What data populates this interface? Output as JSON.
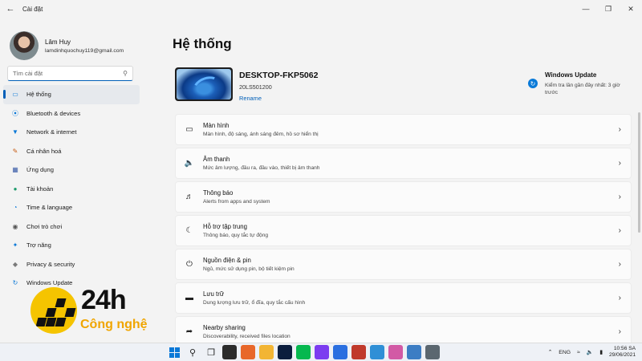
{
  "window": {
    "title": "Cài đặt",
    "back_icon": "back-arrow-icon",
    "controls": [
      "minimize-icon",
      "maximize-icon",
      "close-icon"
    ]
  },
  "profile": {
    "name": "Lâm Huy",
    "email": "lamdinhquochuy119@gmail.com"
  },
  "search": {
    "placeholder": "Tìm cài đặt",
    "icon": "search-icon"
  },
  "sidebar": {
    "items": [
      {
        "label": "Hệ thống",
        "icon": "system-icon",
        "color": "#0a78d7",
        "active": true
      },
      {
        "label": "Bluetooth & devices",
        "icon": "bluetooth-icon",
        "color": "#0a78d7"
      },
      {
        "label": "Network & internet",
        "icon": "wifi-icon",
        "color": "#0a78d7"
      },
      {
        "label": "Cá nhân hoá",
        "icon": "brush-icon",
        "color": "#c75b12"
      },
      {
        "label": "Ứng dụng",
        "icon": "apps-icon",
        "color": "#3a5ca8"
      },
      {
        "label": "Tài khoản",
        "icon": "account-icon",
        "color": "#1f9c6d"
      },
      {
        "label": "Time & language",
        "icon": "globe-icon",
        "color": "#0a78d7"
      },
      {
        "label": "Chơi trò chơi",
        "icon": "gamepad-icon",
        "color": "#555555"
      },
      {
        "label": "Trợ năng",
        "icon": "accessibility-icon",
        "color": "#0a78d7"
      },
      {
        "label": "Privacy & security",
        "icon": "shield-icon",
        "color": "#7a7a7a"
      },
      {
        "label": "Windows Update",
        "icon": "update-icon",
        "color": "#0a78d7"
      }
    ]
  },
  "main": {
    "title": "Hệ thống",
    "device": {
      "name": "DESKTOP-FKP5062",
      "model": "20LS501200",
      "rename": "Rename"
    },
    "windows_update": {
      "title": "Windows Update",
      "subtitle": "Kiểm tra lần gần đây nhất: 3 giờ trước"
    },
    "cards": [
      {
        "title": "Màn hình",
        "subtitle": "Màn hình, độ sáng, ánh sáng đêm, hồ sơ hiển thị",
        "icon": "display-icon"
      },
      {
        "title": "Âm thanh",
        "subtitle": "Mức âm lượng, đầu ra, đầu vào, thiết bị âm thanh",
        "icon": "speaker-icon"
      },
      {
        "title": "Thông báo",
        "subtitle": "Alerts from apps and system",
        "icon": "bell-icon"
      },
      {
        "title": "Hỗ trợ tập trung",
        "subtitle": "Thông báo, quy tắc tự động",
        "icon": "moon-icon"
      },
      {
        "title": "Nguồn điện & pin",
        "subtitle": "Ngủ, mức sử dụng pin, bộ tiết kiệm pin",
        "icon": "power-icon"
      },
      {
        "title": "Lưu trữ",
        "subtitle": "Dung lượng lưu trữ, ổ đĩa, quy tắc cấu hình",
        "icon": "storage-icon"
      },
      {
        "title": "Nearby sharing",
        "subtitle": "Discoverability, received files location",
        "icon": "share-icon"
      }
    ]
  },
  "watermark": {
    "brand": "24h",
    "tagline": "Công nghệ"
  },
  "taskbar": {
    "apps": [
      {
        "name": "start-icon",
        "color": "#0a78d7"
      },
      {
        "name": "taskbar-search-icon",
        "color": "#222222"
      },
      {
        "name": "task-view-icon",
        "color": "#222222"
      },
      {
        "name": "widgets-icon",
        "color": "#2b2b2b"
      },
      {
        "name": "firefox-icon",
        "color": "#e8672a"
      },
      {
        "name": "file-explorer-icon",
        "color": "#f2b534"
      },
      {
        "name": "photoshop-icon",
        "color": "#0b1d3d"
      },
      {
        "name": "line-icon",
        "color": "#06b84f"
      },
      {
        "name": "messenger-icon",
        "color": "#7b3cf0"
      },
      {
        "name": "browser-icon",
        "color": "#2a6fe0"
      },
      {
        "name": "snipping-icon",
        "color": "#c0392b"
      },
      {
        "name": "notepad-icon",
        "color": "#2f8fd6"
      },
      {
        "name": "itunes-icon",
        "color": "#d25aa5"
      },
      {
        "name": "calendar-icon",
        "color": "#3c7dc4"
      },
      {
        "name": "settings-icon",
        "color": "#5b6770"
      }
    ],
    "tray": {
      "lang": "ENG",
      "time": "10:56 SA",
      "date": "29/06/2021"
    }
  }
}
